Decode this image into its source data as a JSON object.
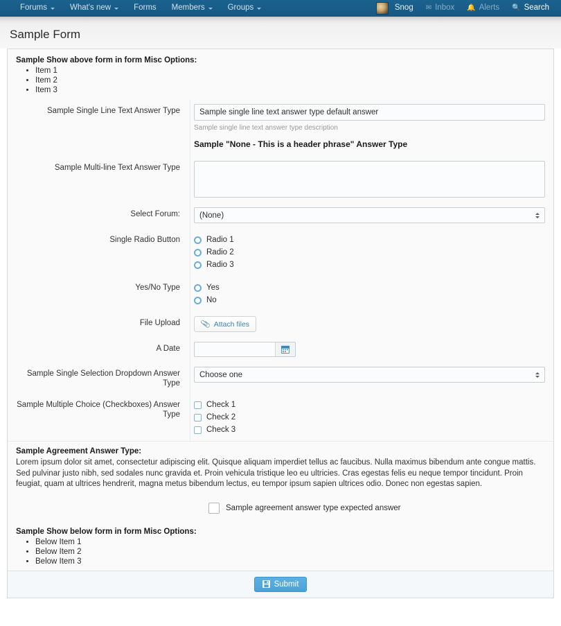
{
  "nav": {
    "left_items": [
      {
        "label": "Forums",
        "caret": true
      },
      {
        "label": "What's new",
        "caret": true
      },
      {
        "label": "Forms",
        "caret": false
      },
      {
        "label": "Members",
        "caret": true
      },
      {
        "label": "Groups",
        "caret": true
      }
    ],
    "right_items": [
      {
        "label": "Snog",
        "icon": "avatar-icon",
        "state": "user"
      },
      {
        "label": "Inbox",
        "icon": "envelope-icon",
        "state": "dim"
      },
      {
        "label": "Alerts",
        "icon": "bell-icon",
        "state": "dim"
      },
      {
        "label": "Search",
        "icon": "search-icon",
        "state": "bright"
      }
    ]
  },
  "page": {
    "title": "Sample Form"
  },
  "misc_above": {
    "title": "Sample Show above form in form Misc Options:",
    "items": [
      "Item 1",
      "Item 2",
      "Item 3"
    ]
  },
  "fields": {
    "single_line": {
      "label": "Sample Single Line Text Answer Type",
      "value": "Sample single line text answer type default answer",
      "description": "Sample single line text answer type description"
    },
    "header_phrase": "Sample \"None - This is a header phrase\" Answer Type",
    "multi_line": {
      "label": "Sample Multi-line Text Answer Type",
      "value": ""
    },
    "select_forum": {
      "label": "Select Forum:",
      "value": "(None)"
    },
    "single_radio": {
      "label": "Single Radio Button",
      "options": [
        "Radio 1",
        "Radio 2",
        "Radio 3"
      ]
    },
    "yes_no": {
      "label": "Yes/No Type",
      "options": [
        "Yes",
        "No"
      ]
    },
    "file_upload": {
      "label": "File Upload",
      "button": "Attach files"
    },
    "date": {
      "label": "A Date",
      "value": ""
    },
    "dropdown": {
      "label": "Sample Single Selection Dropdown Answer Type",
      "value": "Choose one"
    },
    "checkboxes": {
      "label": "Sample Multiple Choice (Checkboxes) Answer Type",
      "options": [
        "Check 1",
        "Check 2",
        "Check 3"
      ]
    }
  },
  "agreement": {
    "title": "Sample Agreement Answer Type:",
    "text": "Lorem ipsum dolor sit amet, consectetur adipiscing elit. Quisque aliquam imperdiet tellus ac faucibus. Nulla maximus bibendum ante congue mattis. Sed pulvinar justo nibh, sed sodales nunc gravida et. Proin vehicula tristique leo eu ultricies. Cras egestas felis eu neque tempor tincidunt. Proin feugiat, quam at ultrices hendrerit, magna metus bibendum lectus, eu tempor ipsum sapien ultrices odio. Donec non egestas sapien.",
    "confirm_label": "Sample agreement answer type expected answer"
  },
  "misc_below": {
    "title": "Sample Show below form in form Misc Options:",
    "items": [
      "Below Item 1",
      "Below Item 2",
      "Below Item 3"
    ]
  },
  "submit": {
    "label": "Submit",
    "icon": "save-icon"
  },
  "colors": {
    "nav_bg": "#1b628f",
    "accent": "#4aa3d8",
    "link": "#3a86b8",
    "panel_bg": "#fafafa"
  }
}
